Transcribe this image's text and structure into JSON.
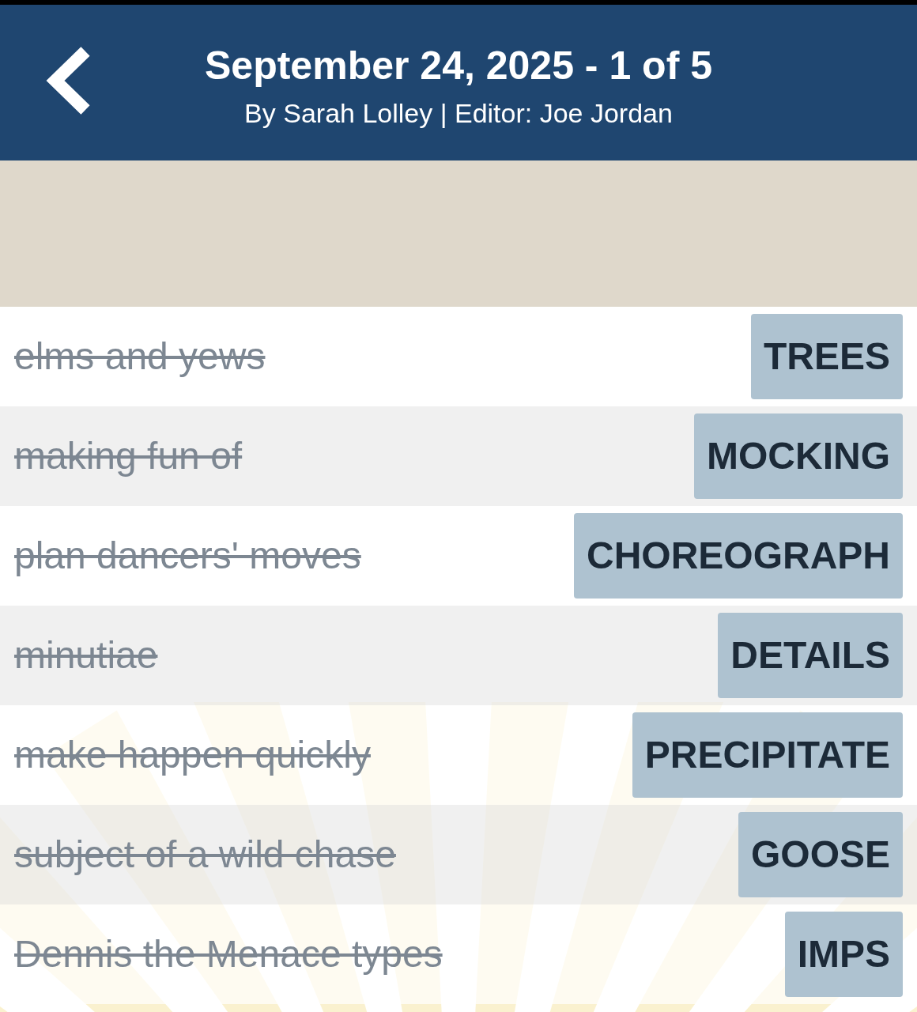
{
  "header": {
    "title": "September 24, 2025 - 1 of 5",
    "byline": "By Sarah Lolley | Editor: Joe Jordan"
  },
  "rows": [
    {
      "clue": "elms and yews",
      "answer": "TREES",
      "crossed_out": true
    },
    {
      "clue": "making fun of",
      "answer": "MOCKING",
      "crossed_out": true
    },
    {
      "clue": "plan dancers' moves",
      "answer": "CHOREOGRAPH",
      "crossed_out": true
    },
    {
      "clue": "minutiae",
      "answer": "DETAILS",
      "crossed_out": true
    },
    {
      "clue": "make happen quickly",
      "answer": "PRECIPITATE",
      "crossed_out": true
    },
    {
      "clue": "subject of a wild chase",
      "answer": "GOOSE",
      "crossed_out": true
    },
    {
      "clue": "Dennis the Menace types",
      "answer": "IMPS",
      "crossed_out": true
    }
  ]
}
